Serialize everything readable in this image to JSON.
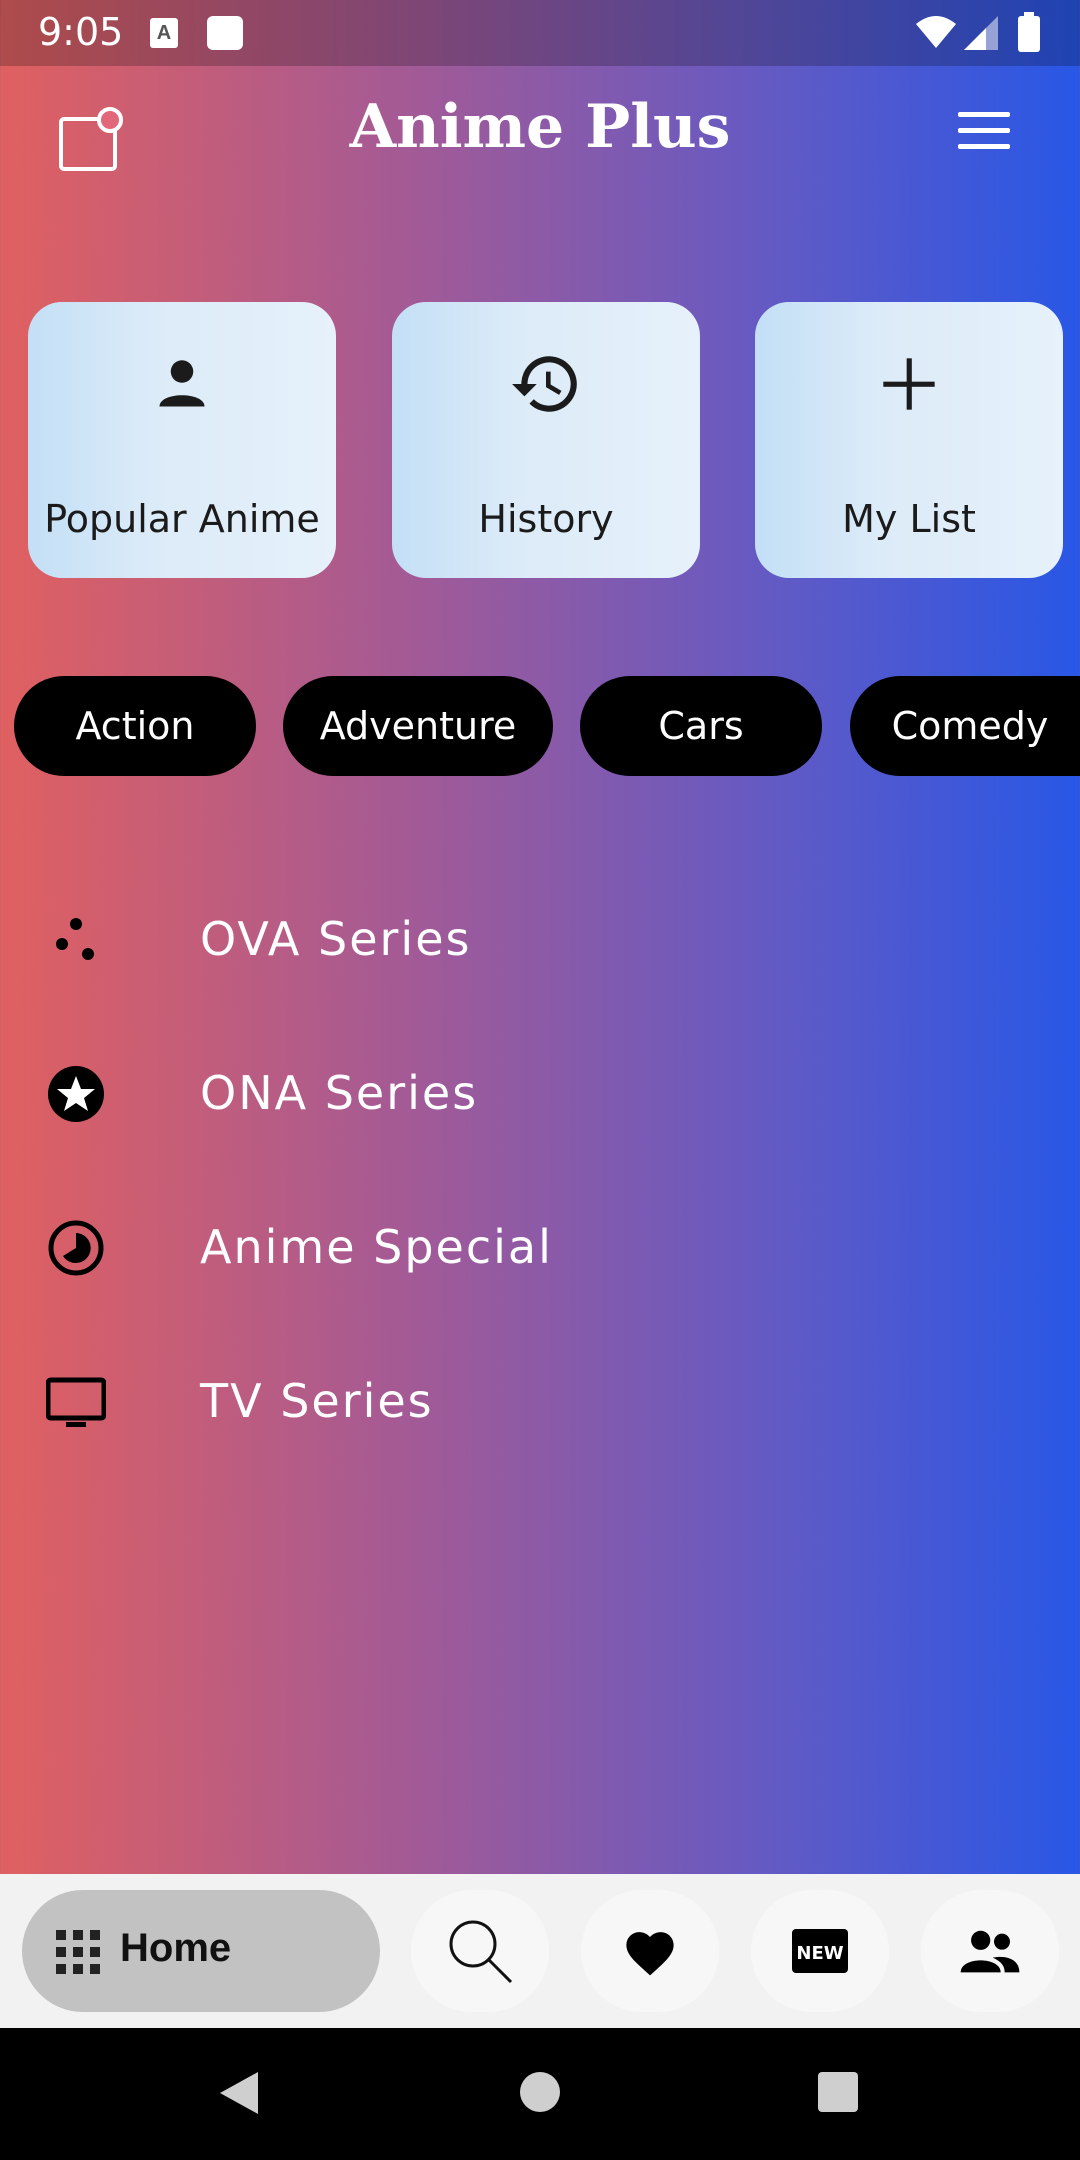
{
  "status_bar": {
    "time": "9:05",
    "icons": [
      "a-notification-icon",
      "square-notification-icon",
      "wifi-icon",
      "signal-icon",
      "battery-icon"
    ]
  },
  "app_bar": {
    "title": "Anime Plus",
    "left_icon": "notification-square-icon",
    "right_icon": "menu-icon"
  },
  "quick_cards": [
    {
      "label": "Popular Anime",
      "icon": "person-icon"
    },
    {
      "label": "History",
      "icon": "history-icon"
    },
    {
      "label": "My List",
      "icon": "plus-icon"
    }
  ],
  "genres": [
    "Action",
    "Adventure",
    "Cars",
    "Comedy"
  ],
  "categories": [
    {
      "label": "OVA Series",
      "icon": "dots-icon"
    },
    {
      "label": "ONA Series",
      "icon": "star-circle-icon"
    },
    {
      "label": "Anime Special",
      "icon": "pie-circle-icon"
    },
    {
      "label": "TV Series",
      "icon": "tv-icon"
    }
  ],
  "bottom_nav": {
    "home_label": "Home",
    "items": [
      "grid-icon",
      "search-icon",
      "heart-icon",
      "new-icon",
      "people-icon"
    ],
    "new_badge_text": "NEW"
  },
  "colors": {
    "gradient_left": "#E06060",
    "gradient_mid": "#6A5AC0",
    "gradient_right": "#2857E6",
    "chip_bg": "#000000",
    "card_bg": "#DCEBF8",
    "nav_home_bg": "#C2C2C2"
  }
}
